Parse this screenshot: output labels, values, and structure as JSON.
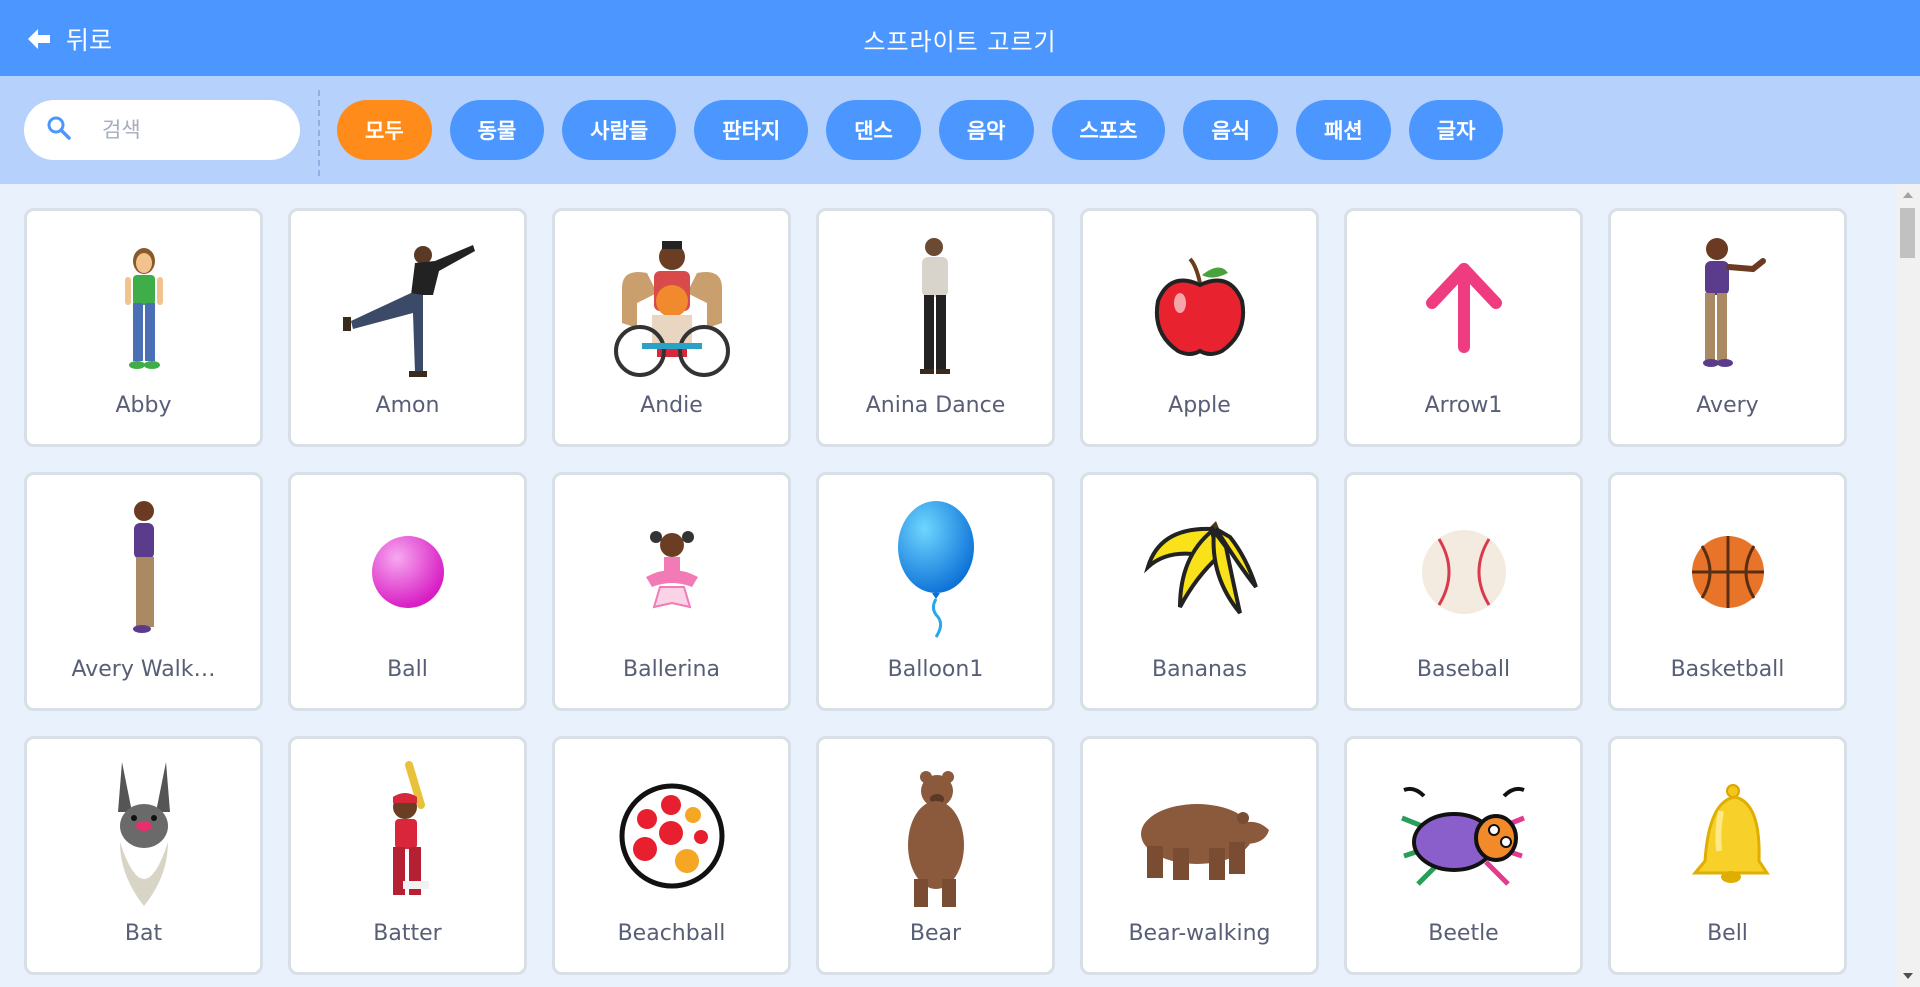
{
  "header": {
    "back_label": "뒤로",
    "title": "스프라이트 고르기"
  },
  "search": {
    "placeholder": "검색"
  },
  "tags": [
    "모두",
    "동물",
    "사람들",
    "판타지",
    "댄스",
    "음악",
    "스포츠",
    "음식",
    "패션",
    "글자"
  ],
  "active_tag": "모두",
  "sprites": [
    {
      "name": "Abby",
      "icon": "abby-girl-icon"
    },
    {
      "name": "Amon",
      "icon": "amon-dancer-icon"
    },
    {
      "name": "Andie",
      "icon": "andie-wheelchair-icon"
    },
    {
      "name": "Anina Dance",
      "icon": "anina-dancer-icon"
    },
    {
      "name": "Apple",
      "icon": "apple-icon"
    },
    {
      "name": "Arrow1",
      "icon": "arrow-up-icon"
    },
    {
      "name": "Avery",
      "icon": "avery-girl-icon"
    },
    {
      "name": "Avery Walk…",
      "icon": "avery-walking-icon"
    },
    {
      "name": "Ball",
      "icon": "ball-icon"
    },
    {
      "name": "Ballerina",
      "icon": "ballerina-icon"
    },
    {
      "name": "Balloon1",
      "icon": "balloon-icon"
    },
    {
      "name": "Bananas",
      "icon": "bananas-icon"
    },
    {
      "name": "Baseball",
      "icon": "baseball-icon"
    },
    {
      "name": "Basketball",
      "icon": "basketball-icon"
    },
    {
      "name": "Bat",
      "icon": "bat-icon"
    },
    {
      "name": "Batter",
      "icon": "batter-icon"
    },
    {
      "name": "Beachball",
      "icon": "beachball-icon"
    },
    {
      "name": "Bear",
      "icon": "bear-standing-icon"
    },
    {
      "name": "Bear-walking",
      "icon": "bear-walking-icon"
    },
    {
      "name": "Beetle",
      "icon": "beetle-icon"
    },
    {
      "name": "Bell",
      "icon": "bell-icon"
    }
  ],
  "colors": {
    "header": "#4c97ff",
    "filterbar": "#b5d1fc",
    "active_tag": "#ff8c1a",
    "tag": "#4c97ff",
    "background": "#e9f1fc"
  }
}
